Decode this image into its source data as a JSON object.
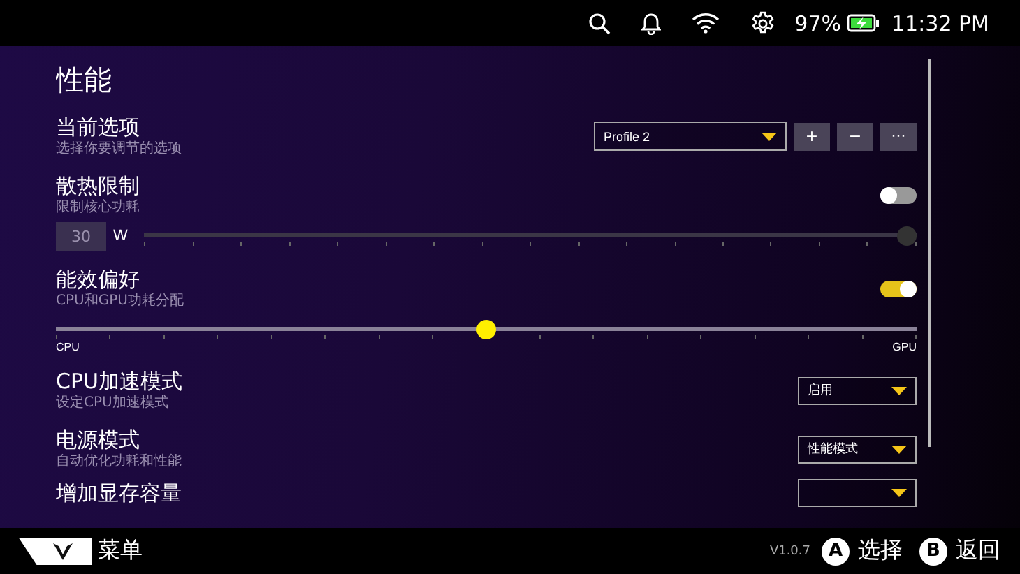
{
  "status_bar": {
    "battery_percent": "97%",
    "time": "11:32 PM"
  },
  "title": "性能",
  "settings": [
    {
      "kind": "profile",
      "label": "当前选项",
      "description": "选择你要调节的选项",
      "value": "Profile 2",
      "buttons": [
        "+",
        "−",
        "···"
      ]
    },
    {
      "kind": "toggle_slider",
      "label": "散热限制",
      "description": "限制核心功耗",
      "on": false,
      "input_value": "30",
      "unit": "W",
      "slider": {
        "level": 1,
        "disabled": true
      }
    },
    {
      "kind": "toggle_slider",
      "label": "能效偏好",
      "description": "CPU和GPU功耗分配",
      "on": true,
      "slider": {
        "level": 0.5,
        "disabled": false,
        "min_label": "CPU",
        "max_label": "GPU"
      }
    },
    {
      "kind": "dropdown",
      "label": "CPU加速模式",
      "description": "设定CPU加速模式",
      "value": "启用"
    },
    {
      "kind": "dropdown",
      "label": "电源模式",
      "description": "自动优化功耗和性能",
      "value": "性能模式"
    },
    {
      "kind": "partial",
      "label": "增加显存容量"
    }
  ],
  "bottom_bar": {
    "menu_label": "菜单",
    "version": "V1.0.7",
    "actions": [
      {
        "key": "A",
        "label": "选择"
      },
      {
        "key": "B",
        "label": "返回"
      }
    ]
  }
}
